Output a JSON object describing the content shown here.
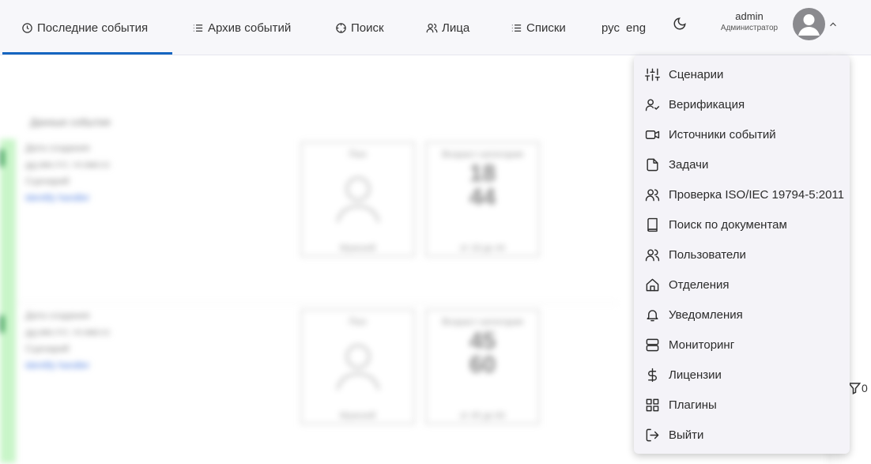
{
  "nav": {
    "items": [
      {
        "label": "Последние события",
        "icon": "clock-icon",
        "active": true
      },
      {
        "label": "Архив событий",
        "icon": "list-icon"
      },
      {
        "label": "Поиск",
        "icon": "target-icon"
      },
      {
        "label": "Лица",
        "icon": "users-icon"
      },
      {
        "label": "Списки",
        "icon": "list-icon"
      }
    ],
    "lang_ru": "рус",
    "lang_en": "eng"
  },
  "user": {
    "name": "admin",
    "role": "Администратор"
  },
  "menu": {
    "items": [
      {
        "label": "Сценарии",
        "icon": "sliders-icon"
      },
      {
        "label": "Верификация",
        "icon": "user-check-icon"
      },
      {
        "label": "Источники событий",
        "icon": "video-icon"
      },
      {
        "label": "Задачи",
        "icon": "file-icon"
      },
      {
        "label": "Проверка ISO/IEC 19794-5:2011",
        "icon": "users-icon"
      },
      {
        "label": "Поиск по документам",
        "icon": "book-icon"
      },
      {
        "label": "Пользователи",
        "icon": "users-icon"
      },
      {
        "label": "Отделения",
        "icon": "home-icon"
      },
      {
        "label": "Уведомления",
        "icon": "bell-icon"
      },
      {
        "label": "Мониторинг",
        "icon": "server-icon"
      },
      {
        "label": "Лицензии",
        "icon": "dollar-icon"
      },
      {
        "label": "Плагины",
        "icon": "grid-icon"
      },
      {
        "label": "Выйти",
        "icon": "logout-icon"
      }
    ]
  },
  "filter": {
    "count": "0"
  },
  "background": {
    "section_title": "Данные события",
    "events": [
      {
        "date_label": "Дата создания",
        "date": "дд.мм.гггг, чч:мм:сс",
        "scenario_label": "Сценарий",
        "scenario": "identify handler",
        "gender_label": "Пол",
        "gender": "Мужской",
        "age_label": "Возраст категория",
        "age_from": "18",
        "age_to": "44",
        "age_range": "от 18 до 44"
      },
      {
        "date_label": "Дата создания",
        "date": "дд.мм.гггг, чч:мм:сс",
        "scenario_label": "Сценарий",
        "scenario": "identify handler",
        "gender_label": "Пол",
        "gender": "Мужской",
        "age_label": "Возраст категория",
        "age_from": "45",
        "age_to": "60",
        "age_range": "от 45 до 60"
      }
    ]
  }
}
